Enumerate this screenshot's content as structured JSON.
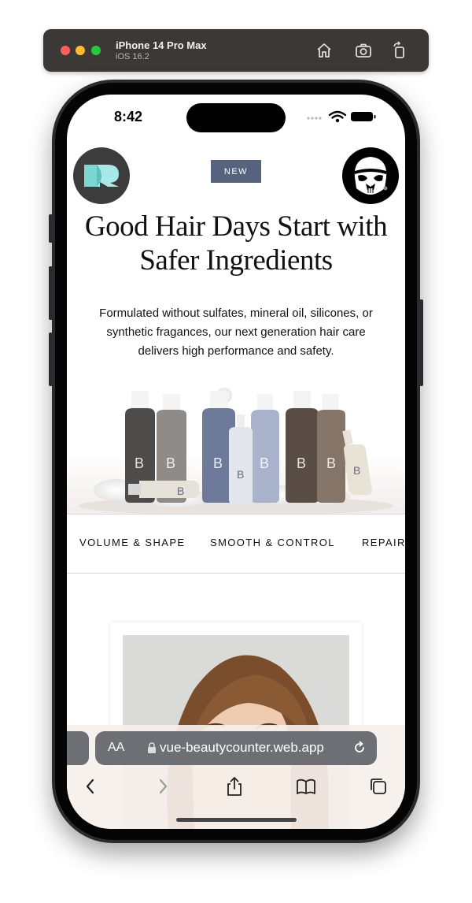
{
  "simulator": {
    "device_name": "iPhone 14 Pro Max",
    "os_version": "iOS 16.2",
    "home_icon": "home-icon",
    "screenshot_icon": "camera-icon",
    "rotate_icon": "rotate-icon"
  },
  "status_bar": {
    "time": "8:42",
    "wifi_icon": "wifi-icon",
    "battery_icon": "battery-icon"
  },
  "header": {
    "badge": "NEW",
    "logo_icon": "brand-logo",
    "avatar_icon": "stormtrooper-avatar"
  },
  "hero": {
    "title": "Good Hair Days Start with Safer Ingredients",
    "description": "Formulated without sulfates, mineral oil, silicones, or synthetic fragances, our next generation hair care delivers high performance and safety."
  },
  "categories": [
    {
      "label": "VOLUME & SHAPE"
    },
    {
      "label": "SMOOTH & CONTROL"
    },
    {
      "label": "REPAIR"
    }
  ],
  "browser": {
    "aa_label": "AA",
    "url": "vue-beautycounter.web.app",
    "back_icon": "chevron-left-icon",
    "forward_icon": "chevron-right-icon",
    "share_icon": "share-icon",
    "bookmarks_icon": "book-icon",
    "tabs_icon": "tabs-icon"
  },
  "colors": {
    "badge_bg": "#56627e",
    "address_bar_bg": "#6e6f74",
    "logo_teal": "#7ed6d3"
  }
}
